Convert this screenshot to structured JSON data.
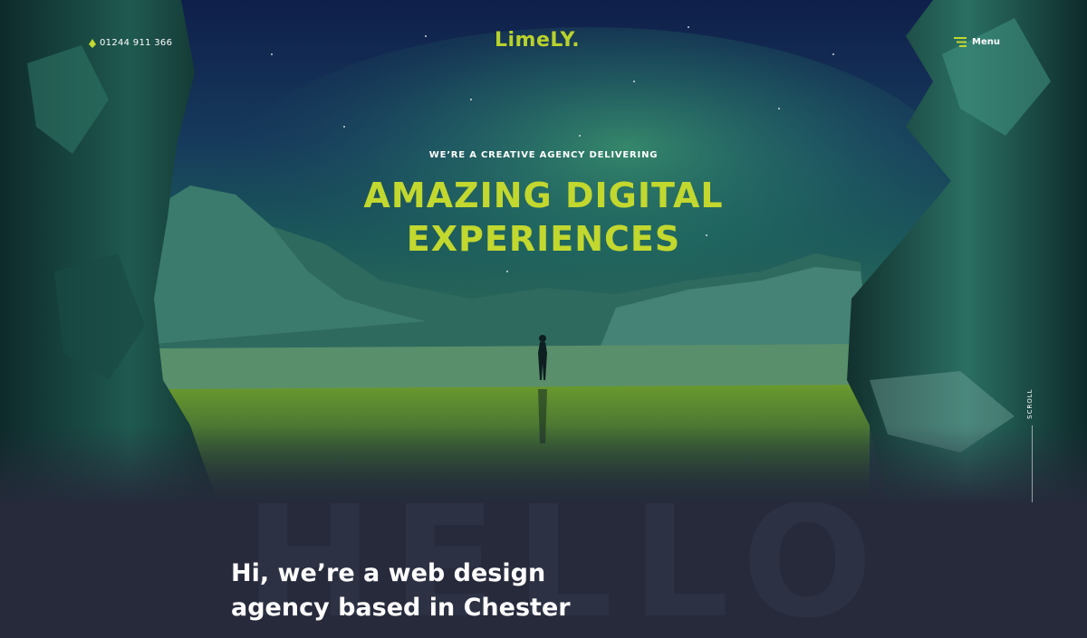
{
  "header": {
    "phone": "01244 911 366",
    "logo": "LimeLY.",
    "menu_label": "Menu"
  },
  "hero": {
    "kicker": "WE’RE A CREATIVE AGENCY DELIVERING",
    "headline_line1": "AMAZING DIGITAL",
    "headline_line2": "EXPERIENCES",
    "scroll_label": "SCROLL"
  },
  "intro": {
    "background_word": "HELLO",
    "heading_line1": "Hi, we’re a web design",
    "heading_line2": "agency based in Chester"
  },
  "colors": {
    "accent": "#c3d82e",
    "dark_bg": "#262a3b",
    "text_light": "#ffffff"
  },
  "icons": {
    "phone": "phone-icon",
    "menu": "menu-icon"
  }
}
